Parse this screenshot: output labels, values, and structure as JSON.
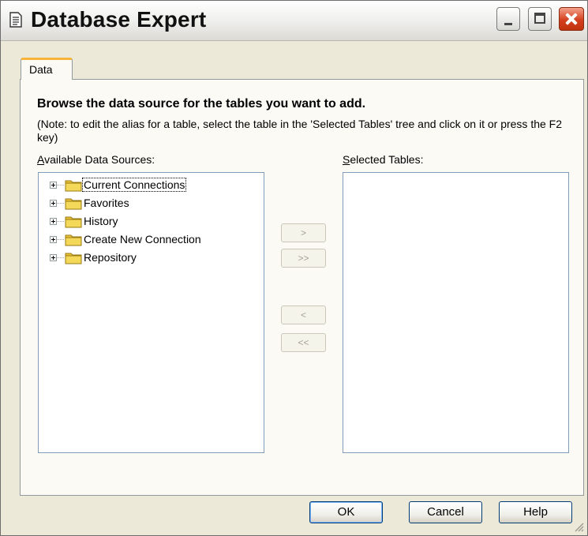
{
  "window": {
    "title": "Database Expert",
    "icon": "document-icon"
  },
  "tabs": [
    {
      "label": "Data",
      "active": true
    }
  ],
  "content": {
    "heading": "Browse the data source for the tables you want to add.",
    "note": "(Note: to edit the alias for a table, select the table in the 'Selected Tables' tree and click on it or press the F2 key)"
  },
  "available": {
    "label_prefix": "",
    "label_accel": "A",
    "label_rest": "vailable Data Sources:",
    "items": [
      {
        "label": "Current Connections",
        "focused": true
      },
      {
        "label": "Favorites"
      },
      {
        "label": "History"
      },
      {
        "label": "Create New Connection"
      },
      {
        "label": "Repository"
      }
    ]
  },
  "selected": {
    "label_accel": "S",
    "label_rest": "elected Tables:",
    "items": []
  },
  "move_buttons": {
    "add": ">",
    "add_all": ">>",
    "remove": "<",
    "remove_all": "<<"
  },
  "footer": {
    "ok": "OK",
    "cancel": "Cancel",
    "help": "Help"
  },
  "colors": {
    "dialog_bg": "#ece9d8",
    "panel_bg": "#fbfaf5",
    "tab_accent": "#f6b53a",
    "close_red": "#d43f1c",
    "folder_yellow": "#f4d85a"
  }
}
